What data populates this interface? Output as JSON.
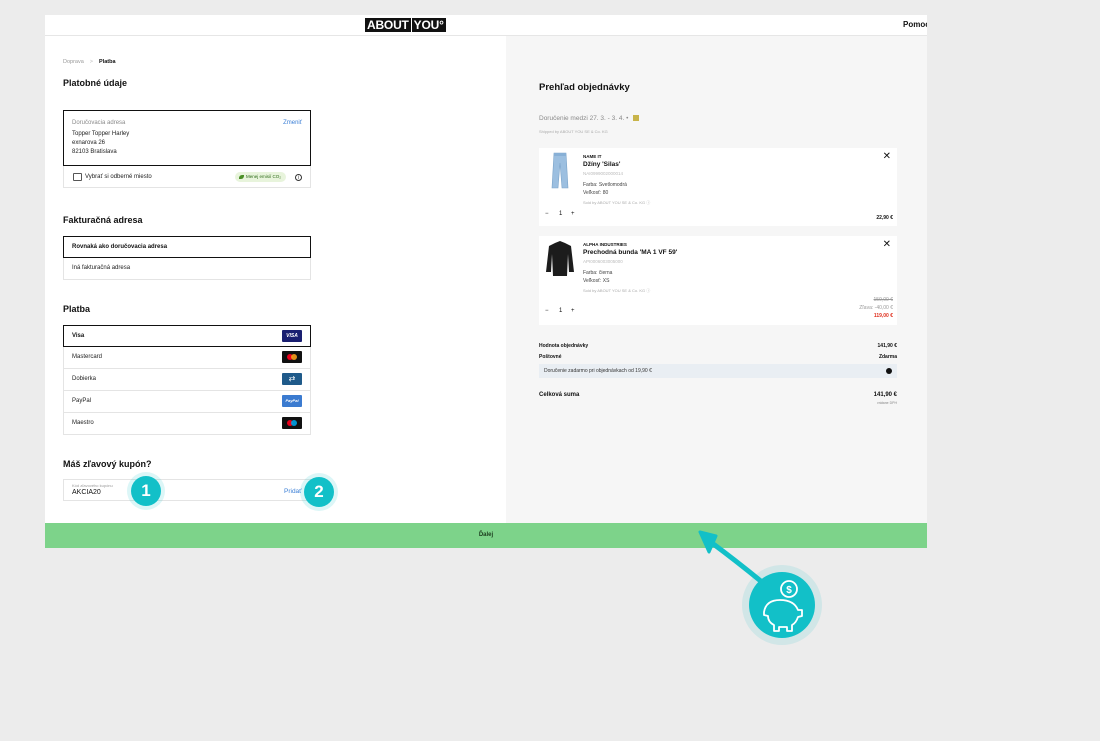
{
  "header": {
    "logo_part1": "ABOUT",
    "logo_part2": "YOU",
    "logo_mark": "°",
    "help_label": "Pomoc"
  },
  "breadcrumb": {
    "step1": "Doprava",
    "separator": ">",
    "step2": "Platba"
  },
  "payment_details": {
    "title": "Platobné údaje",
    "delivery_address": {
      "label": "Doručovacia adresa",
      "change_label": "Zmeniť",
      "name": "Topper Topper Harley",
      "street": "exnarova 26",
      "city": "82103 Bratislava"
    },
    "pickup": {
      "label": "Vybrať si odberné miesto",
      "co2_badge": "Menej emisií CO₂",
      "icon": "store-icon"
    }
  },
  "billing": {
    "title": "Fakturačná adresa",
    "options": [
      {
        "label": "Rovnaká ako doručovacia adresa",
        "selected": true
      },
      {
        "label": "Iná fakturačná adresa",
        "selected": false
      }
    ]
  },
  "payment": {
    "title": "Platba",
    "methods": [
      {
        "label": "Visa",
        "logo_text": "VISA",
        "selected": true
      },
      {
        "label": "Mastercard",
        "selected": false
      },
      {
        "label": "Dobierka",
        "logo_text": "⇄",
        "selected": false
      },
      {
        "label": "PayPal",
        "logo_text": "PayPal",
        "selected": false
      },
      {
        "label": "Maestro",
        "selected": false
      }
    ]
  },
  "coupon": {
    "title": "Máš zľavový kupón?",
    "field_label": "Kód zľavového kupónu",
    "value": "AKCIA20",
    "add_label": "Pridať"
  },
  "next_button": {
    "label": "Ďalej"
  },
  "overview": {
    "title": "Prehľad objednávky",
    "delivery_text": "Doručenie medzi 27. 3. - 3. 4. •",
    "shipped_by": "Shipped by ABOUT YOU SE & Co. KG",
    "items": [
      {
        "brand": "NAME IT",
        "name": "Džíny 'Silas'",
        "sku": "NAI0999002000014",
        "color": "Farba: Svetlomodrá",
        "size": "Veľkosť: 80",
        "sold_by": "Sold by ABOUT YOU SE & Co. KG ⓘ",
        "qty": "1",
        "price": "22,90 €"
      },
      {
        "brand": "ALPHA INDUSTRIES",
        "name": "Prechodná bunda 'MA 1 VF 59'",
        "sku": "API0006003005000",
        "color": "Farba: čierna",
        "size": "Veľkosť: XS",
        "sold_by": "Sold by ABOUT YOU SE & Co. KG ⓘ",
        "qty": "1",
        "price_old": "159,00 €",
        "discount": "Zľava: -40,00 €",
        "price": "119,00 €"
      }
    ],
    "subtotal_label": "Hodnota objednávky",
    "subtotal_value": "141,90 €",
    "shipping_label": "Poštovné",
    "shipping_value": "Zdarma",
    "free_shipping_note": "Doručenie zadarmo pri objednávkach od 19,90 €",
    "total_label": "Celková suma",
    "total_value": "141,90 €",
    "vat_note": "vrátane DPH"
  },
  "annotations": {
    "badge1": "1",
    "badge2": "2"
  },
  "colors": {
    "accent_green": "#7dd38a",
    "annotation_teal": "#12c0c8",
    "link_blue": "#3b7fd6",
    "sale_red": "#e0301e"
  }
}
